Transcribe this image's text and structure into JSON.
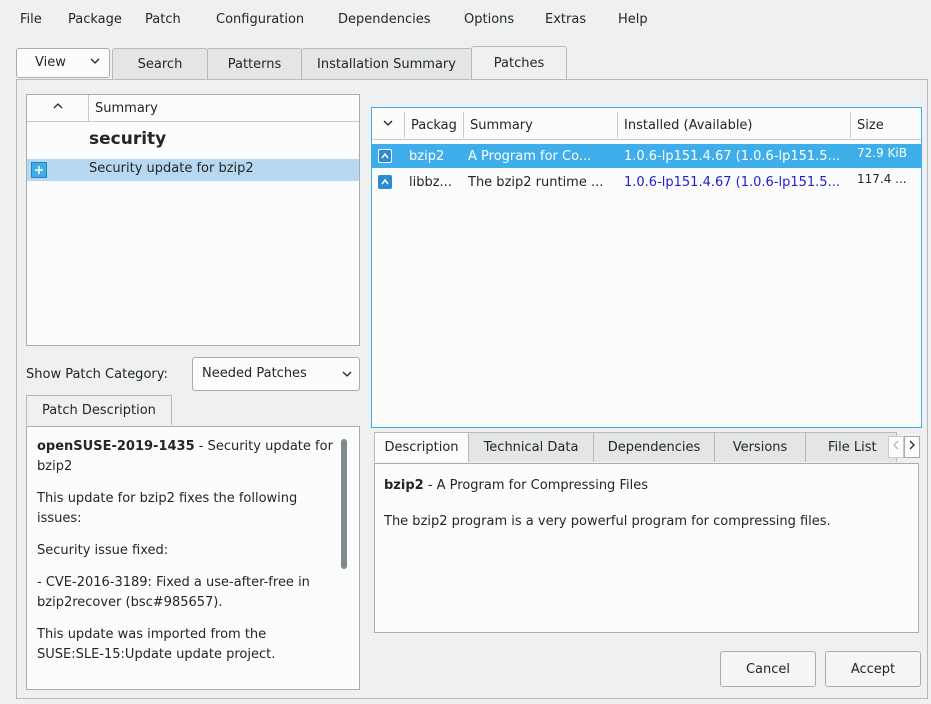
{
  "menubar": {
    "items": [
      "File",
      "Package",
      "Patch",
      "Configuration",
      "Dependencies",
      "Options",
      "Extras",
      "Help"
    ]
  },
  "tabs": {
    "view_label": "View",
    "items": [
      "Search",
      "Patterns",
      "Installation Summary",
      "Patches"
    ],
    "active": "Patches"
  },
  "patch_list": {
    "header_summary": "Summary",
    "category": "security",
    "rows": [
      {
        "summary": "Security update for bzip2",
        "selected": true
      }
    ]
  },
  "category_filter": {
    "label": "Show Patch Category:",
    "selected": "Needed Patches"
  },
  "patch_description": {
    "tab_label": "Patch Description",
    "patch_id": "openSUSE-2019-1435",
    "patch_title_rest": " - Security update for bzip2",
    "paragraphs": [
      "This update for bzip2 fixes the following issues:",
      "Security issue fixed:",
      "- CVE-2016-3189: Fixed a use-after-free in bzip2recover (bsc#985657).",
      "This update was imported from the SUSE:SLE-15:Update update project."
    ]
  },
  "packages": {
    "headers": {
      "package": "Packag",
      "summary": "Summary",
      "installed": "Installed (Available)",
      "size": "Size"
    },
    "rows": [
      {
        "name": "bzip2",
        "summary": "A Program for Co...",
        "installed": "1.0.6-lp151.4.67 (1.0.6-lp151.5...",
        "size": "72.9 KiB",
        "selected": true
      },
      {
        "name": "libbz...",
        "summary": "The bzip2 runtime ...",
        "installed": "1.0.6-lp151.4.67 (1.0.6-lp151.5...",
        "size": "117.4 ...",
        "selected": false
      }
    ]
  },
  "details": {
    "tabs": [
      "Description",
      "Technical Data",
      "Dependencies",
      "Versions",
      "File List"
    ],
    "active_tab": "Description",
    "pkg_name": "bzip2",
    "pkg_title_rest": " - A Program for Compressing Files",
    "body": "The bzip2 program is a very powerful program for compressing files."
  },
  "buttons": {
    "cancel": "Cancel",
    "accept": "Accept"
  },
  "colors": {
    "selection": "#b7d8f0",
    "selection_text": "#ffffff",
    "link_blue": "#1d1dd6",
    "pkg_icon": "#2d8bd0"
  }
}
